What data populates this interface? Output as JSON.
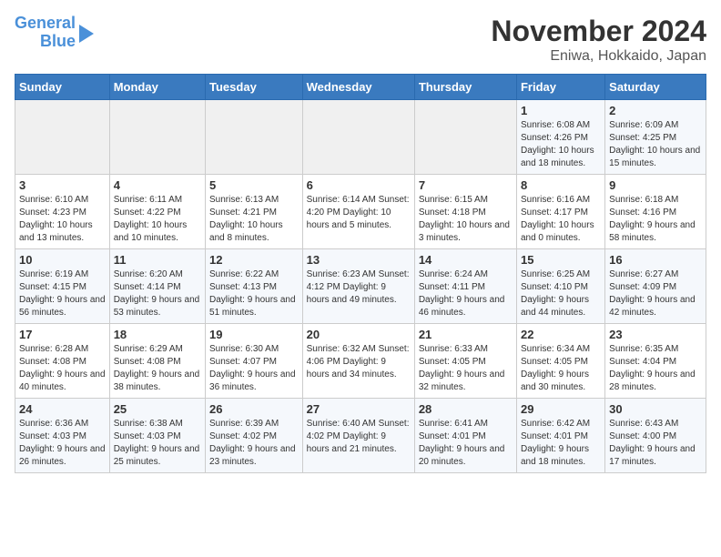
{
  "header": {
    "logo_line1": "General",
    "logo_line2": "Blue",
    "month_title": "November 2024",
    "location": "Eniwa, Hokkaido, Japan"
  },
  "weekdays": [
    "Sunday",
    "Monday",
    "Tuesday",
    "Wednesday",
    "Thursday",
    "Friday",
    "Saturday"
  ],
  "weeks": [
    [
      {
        "day": "",
        "info": ""
      },
      {
        "day": "",
        "info": ""
      },
      {
        "day": "",
        "info": ""
      },
      {
        "day": "",
        "info": ""
      },
      {
        "day": "",
        "info": ""
      },
      {
        "day": "1",
        "info": "Sunrise: 6:08 AM\nSunset: 4:26 PM\nDaylight: 10 hours\nand 18 minutes."
      },
      {
        "day": "2",
        "info": "Sunrise: 6:09 AM\nSunset: 4:25 PM\nDaylight: 10 hours\nand 15 minutes."
      }
    ],
    [
      {
        "day": "3",
        "info": "Sunrise: 6:10 AM\nSunset: 4:23 PM\nDaylight: 10 hours\nand 13 minutes."
      },
      {
        "day": "4",
        "info": "Sunrise: 6:11 AM\nSunset: 4:22 PM\nDaylight: 10 hours\nand 10 minutes."
      },
      {
        "day": "5",
        "info": "Sunrise: 6:13 AM\nSunset: 4:21 PM\nDaylight: 10 hours\nand 8 minutes."
      },
      {
        "day": "6",
        "info": "Sunrise: 6:14 AM\nSunset: 4:20 PM\nDaylight: 10 hours\nand 5 minutes."
      },
      {
        "day": "7",
        "info": "Sunrise: 6:15 AM\nSunset: 4:18 PM\nDaylight: 10 hours\nand 3 minutes."
      },
      {
        "day": "8",
        "info": "Sunrise: 6:16 AM\nSunset: 4:17 PM\nDaylight: 10 hours\nand 0 minutes."
      },
      {
        "day": "9",
        "info": "Sunrise: 6:18 AM\nSunset: 4:16 PM\nDaylight: 9 hours\nand 58 minutes."
      }
    ],
    [
      {
        "day": "10",
        "info": "Sunrise: 6:19 AM\nSunset: 4:15 PM\nDaylight: 9 hours\nand 56 minutes."
      },
      {
        "day": "11",
        "info": "Sunrise: 6:20 AM\nSunset: 4:14 PM\nDaylight: 9 hours\nand 53 minutes."
      },
      {
        "day": "12",
        "info": "Sunrise: 6:22 AM\nSunset: 4:13 PM\nDaylight: 9 hours\nand 51 minutes."
      },
      {
        "day": "13",
        "info": "Sunrise: 6:23 AM\nSunset: 4:12 PM\nDaylight: 9 hours\nand 49 minutes."
      },
      {
        "day": "14",
        "info": "Sunrise: 6:24 AM\nSunset: 4:11 PM\nDaylight: 9 hours\nand 46 minutes."
      },
      {
        "day": "15",
        "info": "Sunrise: 6:25 AM\nSunset: 4:10 PM\nDaylight: 9 hours\nand 44 minutes."
      },
      {
        "day": "16",
        "info": "Sunrise: 6:27 AM\nSunset: 4:09 PM\nDaylight: 9 hours\nand 42 minutes."
      }
    ],
    [
      {
        "day": "17",
        "info": "Sunrise: 6:28 AM\nSunset: 4:08 PM\nDaylight: 9 hours\nand 40 minutes."
      },
      {
        "day": "18",
        "info": "Sunrise: 6:29 AM\nSunset: 4:08 PM\nDaylight: 9 hours\nand 38 minutes."
      },
      {
        "day": "19",
        "info": "Sunrise: 6:30 AM\nSunset: 4:07 PM\nDaylight: 9 hours\nand 36 minutes."
      },
      {
        "day": "20",
        "info": "Sunrise: 6:32 AM\nSunset: 4:06 PM\nDaylight: 9 hours\nand 34 minutes."
      },
      {
        "day": "21",
        "info": "Sunrise: 6:33 AM\nSunset: 4:05 PM\nDaylight: 9 hours\nand 32 minutes."
      },
      {
        "day": "22",
        "info": "Sunrise: 6:34 AM\nSunset: 4:05 PM\nDaylight: 9 hours\nand 30 minutes."
      },
      {
        "day": "23",
        "info": "Sunrise: 6:35 AM\nSunset: 4:04 PM\nDaylight: 9 hours\nand 28 minutes."
      }
    ],
    [
      {
        "day": "24",
        "info": "Sunrise: 6:36 AM\nSunset: 4:03 PM\nDaylight: 9 hours\nand 26 minutes."
      },
      {
        "day": "25",
        "info": "Sunrise: 6:38 AM\nSunset: 4:03 PM\nDaylight: 9 hours\nand 25 minutes."
      },
      {
        "day": "26",
        "info": "Sunrise: 6:39 AM\nSunset: 4:02 PM\nDaylight: 9 hours\nand 23 minutes."
      },
      {
        "day": "27",
        "info": "Sunrise: 6:40 AM\nSunset: 4:02 PM\nDaylight: 9 hours\nand 21 minutes."
      },
      {
        "day": "28",
        "info": "Sunrise: 6:41 AM\nSunset: 4:01 PM\nDaylight: 9 hours\nand 20 minutes."
      },
      {
        "day": "29",
        "info": "Sunrise: 6:42 AM\nSunset: 4:01 PM\nDaylight: 9 hours\nand 18 minutes."
      },
      {
        "day": "30",
        "info": "Sunrise: 6:43 AM\nSunset: 4:00 PM\nDaylight: 9 hours\nand 17 minutes."
      }
    ]
  ]
}
